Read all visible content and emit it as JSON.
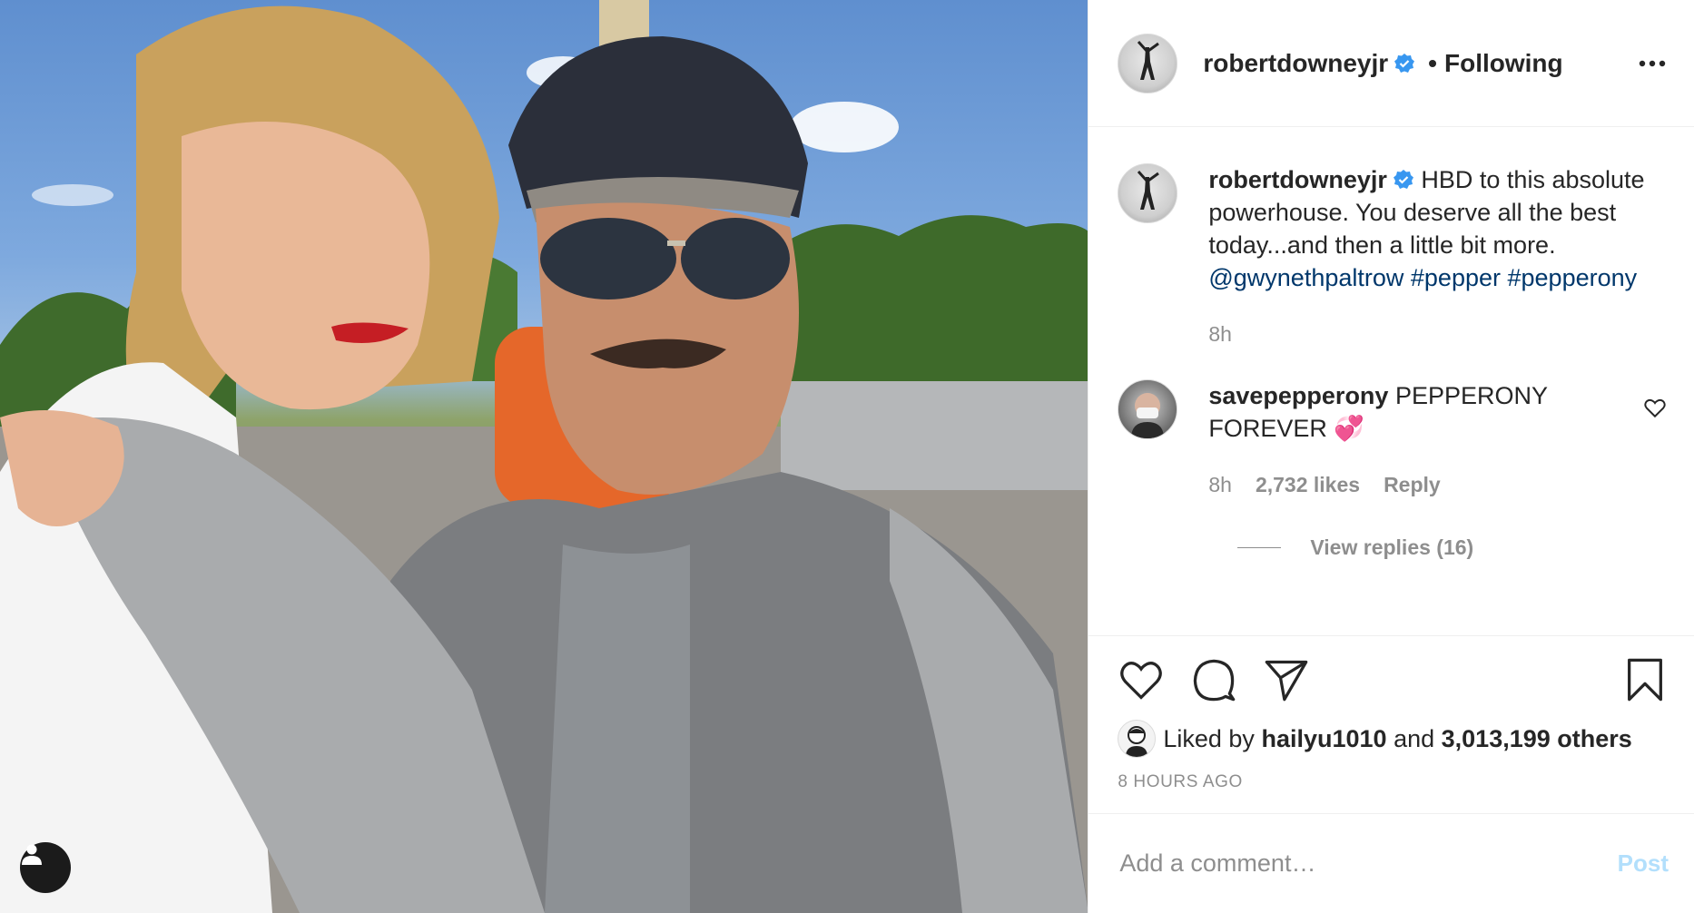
{
  "header": {
    "username": "robertdowneyjr",
    "separator": "•",
    "follow_status": "Following"
  },
  "caption": {
    "username": "robertdowneyjr",
    "text_part1": "HBD to this absolute powerhouse. You deserve all the best today...and then a little bit more.",
    "mention": "@gwynethpaltrow",
    "hashtag1": "#pepper",
    "hashtag2": "#pepperony",
    "time": "8h"
  },
  "comments": [
    {
      "username": "savepepperony",
      "text": "PEPPERONY FOREVER",
      "emoji": "💞",
      "time": "8h",
      "likes": "2,732 likes",
      "reply_label": "Reply",
      "view_replies": "View replies (16)"
    }
  ],
  "likes": {
    "prefix": "Liked by",
    "user": "hailyu1010",
    "and": "and",
    "count": "3,013,199 others"
  },
  "timestamp": "8 HOURS AGO",
  "add_comment": {
    "placeholder": "Add a comment…",
    "post_label": "Post"
  },
  "icons": {
    "verified": "verified-badge-icon",
    "more": "more-horizontal-icon",
    "like": "heart-icon",
    "comment": "comment-bubble-icon",
    "share": "paper-plane-icon",
    "save": "bookmark-icon",
    "tag_user": "user-tag-icon"
  },
  "colors": {
    "verified_blue": "#3897f0",
    "link": "#00376b",
    "muted": "#8e8e8e",
    "post_button_disabled": "#b2dffc"
  }
}
